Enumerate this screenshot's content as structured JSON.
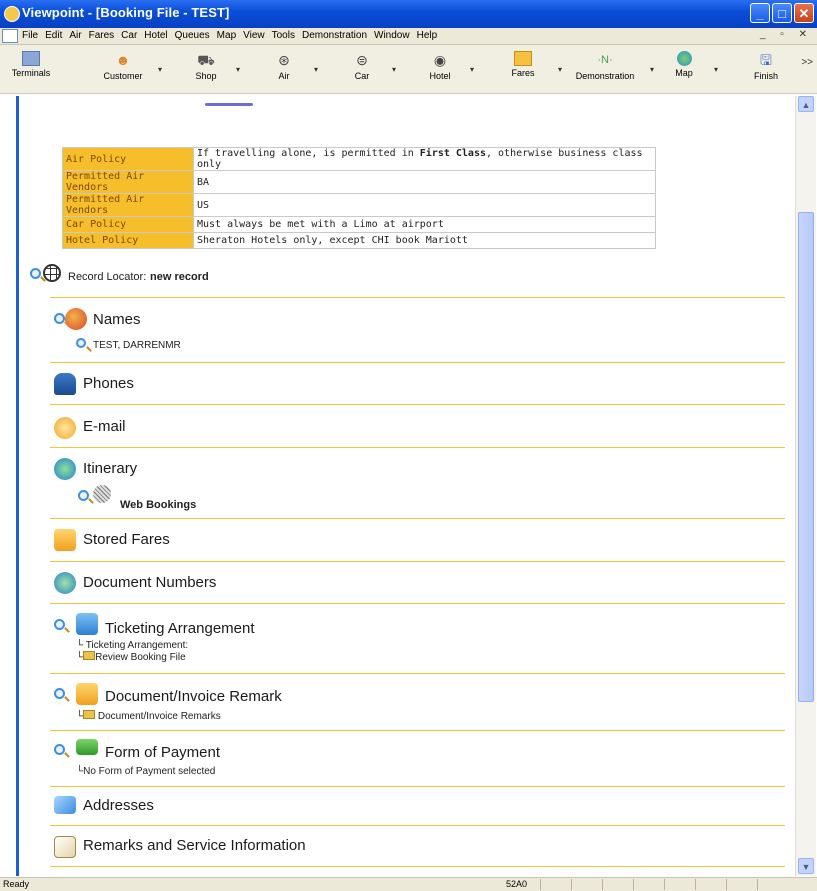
{
  "window": {
    "title": "Viewpoint - [Booking File - TEST]"
  },
  "menu": [
    "File",
    "Edit",
    "Air",
    "Fares",
    "Car",
    "Hotel",
    "Queues",
    "Map",
    "View",
    "Tools",
    "Demonstration",
    "Window",
    "Help"
  ],
  "toolbar": [
    {
      "label": "Terminals",
      "icon": "terminal-icon"
    },
    {
      "label": "Customer",
      "icon": "customer-icon"
    },
    {
      "label": "Shop",
      "icon": "shop-icon"
    },
    {
      "label": "Air",
      "icon": "air-icon"
    },
    {
      "label": "Car",
      "icon": "car-icon"
    },
    {
      "label": "Hotel",
      "icon": "hotel-icon"
    },
    {
      "label": "Fares",
      "icon": "fares-icon"
    },
    {
      "label": "Demonstration",
      "icon": "demonstration-icon"
    },
    {
      "label": "Map",
      "icon": "map-icon"
    },
    {
      "label": "Finish",
      "icon": "finish-icon"
    }
  ],
  "toolbar_more": ">>",
  "policy": [
    {
      "key": "Air Policy",
      "value_pre": "If travelling alone, is permitted in ",
      "value_bold": "First Class",
      "value_post": ", otherwise business class only"
    },
    {
      "key": "Permitted Air Vendors",
      "value_pre": "BA",
      "value_bold": "",
      "value_post": ""
    },
    {
      "key": "Permitted Air Vendors",
      "value_pre": "US",
      "value_bold": "",
      "value_post": ""
    },
    {
      "key": "Car Policy",
      "value_pre": "Must always be met with a Limo at airport",
      "value_bold": "",
      "value_post": ""
    },
    {
      "key": "Hotel Policy",
      "value_pre": "Sheraton Hotels only, except CHI book Mariott",
      "value_bold": "",
      "value_post": ""
    }
  ],
  "record_locator": {
    "label": "Record Locator:",
    "value": "new record"
  },
  "sections": {
    "names": {
      "title": "Names",
      "items": [
        "TEST, DARRENMR"
      ]
    },
    "phones": {
      "title": "Phones"
    },
    "email": {
      "title": "E-mail"
    },
    "itinerary": {
      "title": "Itinerary",
      "items": [
        "Web Bookings"
      ]
    },
    "stored_fares": {
      "title": "Stored Fares"
    },
    "document_numbers": {
      "title": "Document Numbers"
    },
    "ticketing": {
      "title": "Ticketing Arrangement",
      "items": [
        "Ticketing Arrangement:",
        "Review Booking File"
      ]
    },
    "doc_invoice": {
      "title": "Document/Invoice Remark",
      "items": [
        "Document/Invoice Remarks"
      ]
    },
    "payment": {
      "title": "Form of Payment",
      "items": [
        "No Form of Payment selected"
      ]
    },
    "addresses": {
      "title": "Addresses"
    },
    "remarks": {
      "title": "Remarks and Service Information"
    }
  },
  "status": {
    "text": "Ready",
    "code": "52A0"
  },
  "colors": {
    "policy_key": "#f7be2c",
    "divider": "#f5c43a",
    "titlebar": "#0a4fd8"
  }
}
